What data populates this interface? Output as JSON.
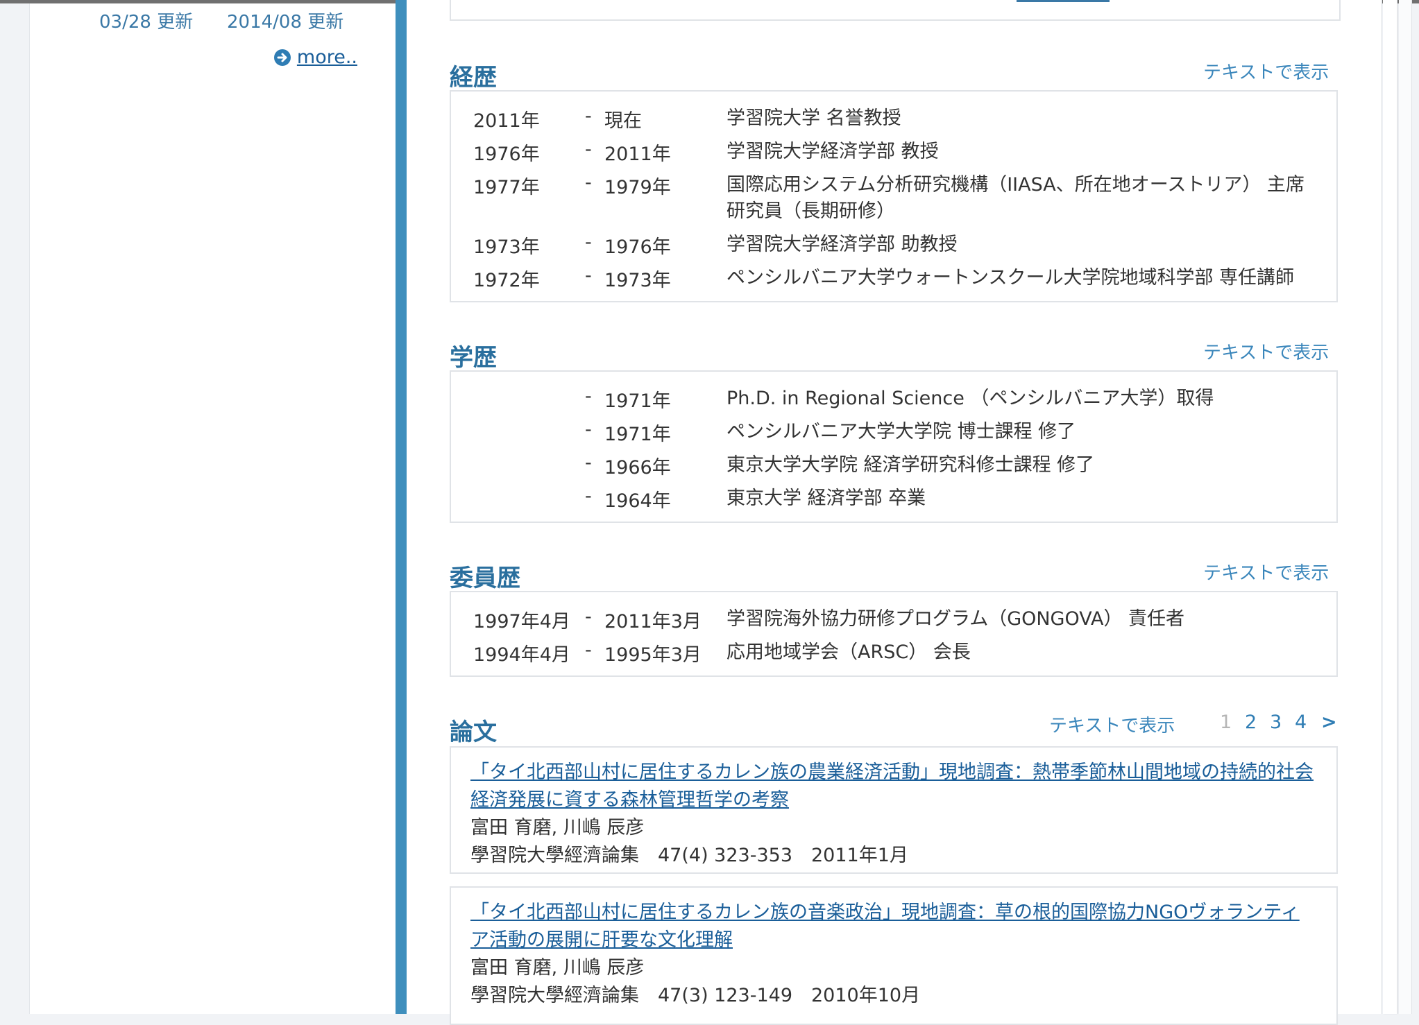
{
  "sidebar": {
    "updates": [
      "03/28 更新",
      "2014/08 更新"
    ],
    "more_label": "more.."
  },
  "career": {
    "title": "経歴",
    "text_link": "テキストで表示",
    "rows": [
      {
        "from": "2011年",
        "to": "現在",
        "desc": "学習院大学 名誉教授"
      },
      {
        "from": "1976年",
        "to": "2011年",
        "desc": "学習院大学経済学部 教授"
      },
      {
        "from": "1977年",
        "to": "1979年",
        "desc": "国際応用システム分析研究機構（IIASA、所在地オーストリア） 主席研究員（長期研修）"
      },
      {
        "from": "1973年",
        "to": "1976年",
        "desc": "学習院大学経済学部 助教授"
      },
      {
        "from": "1972年",
        "to": "1973年",
        "desc": "ペンシルバニア大学ウォートンスクール大学院地域科学部 専任講師"
      }
    ]
  },
  "education": {
    "title": "学歴",
    "text_link": "テキストで表示",
    "rows": [
      {
        "from": "",
        "to": "1971年",
        "desc": "Ph.D. in Regional Science （ペンシルバニア大学）取得"
      },
      {
        "from": "",
        "to": "1971年",
        "desc": "ペンシルバニア大学大学院 博士課程 修了"
      },
      {
        "from": "",
        "to": "1966年",
        "desc": "東京大学大学院 経済学研究科修士課程 修了"
      },
      {
        "from": "",
        "to": "1964年",
        "desc": "東京大学 経済学部 卒業"
      }
    ]
  },
  "committee": {
    "title": "委員歴",
    "text_link": "テキストで表示",
    "rows": [
      {
        "from": "1997年4月",
        "to": "2011年3月",
        "desc": "学習院海外協力研修プログラム（GONGOVA） 責任者"
      },
      {
        "from": "1994年4月",
        "to": "1995年3月",
        "desc": "応用地域学会（ARSC） 会長"
      }
    ]
  },
  "papers": {
    "title": "論文",
    "text_link": "テキストで表示",
    "pagination": {
      "pages": [
        "1",
        "2",
        "3",
        "4"
      ],
      "current": "1",
      "next": ">"
    },
    "items": [
      {
        "title": "「タイ北西部山村に居住するカレン族の農業経済活動」現地調査：熱帯季節林山間地域の持続的社会経済発展に資する森林管理哲学の考察",
        "authors": "富田 育磨, 川嶋 辰彦",
        "source": "學習院大學經濟論集　47(4) 323-353　2011年1月"
      },
      {
        "title": "「タイ北西部山村に居住するカレン族の音楽政治」現地調査：草の根的国際協力NGOヴォランティア活動の展開に肝要な文化理解",
        "authors": "富田 育磨, 川嶋 辰彦",
        "source": "學習院大學經濟論集　47(3) 123-149　2010年10月"
      }
    ]
  }
}
